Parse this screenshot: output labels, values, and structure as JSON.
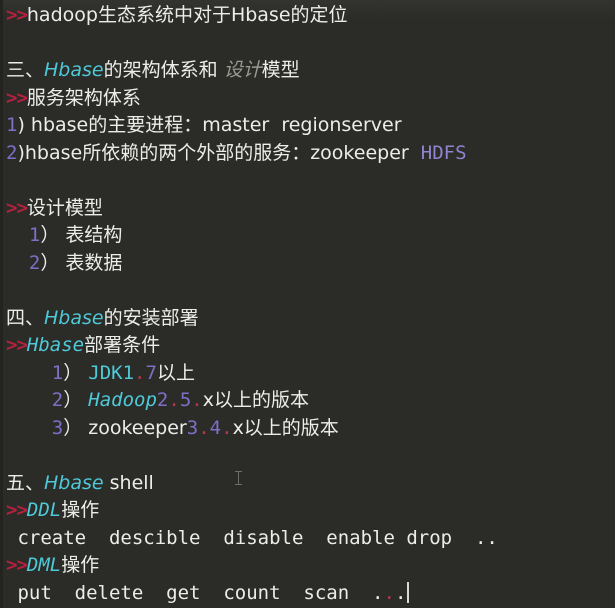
{
  "editor": {
    "theme": "dark",
    "background_color": "#2b2b27",
    "default_text_color": "#ececeb",
    "colors": {
      "marker_red": "#b4203f",
      "keyword_cyan": "#4ec9d8",
      "number_purple": "#7f6fc6",
      "lavender": "#8f84cf",
      "dot_red": "#b8344e",
      "muted_gray": "#9a9a94"
    },
    "caret_visible": true,
    "mouse_cursor": "i-beam"
  },
  "document": {
    "title": "hadoop生态系统中对于Hbase的定位",
    "lines": [
      {
        "id": "line-1",
        "kind": "sub-heading",
        "text": ">>hadoop生态系统中对于Hbase的定位",
        "tokens": [
          {
            "t": ">>",
            "c": "marker"
          },
          {
            "t": "hadoop生态系统中对于Hbase的定位",
            "c": "white"
          }
        ]
      },
      {
        "id": "line-2",
        "kind": "blank",
        "text": "",
        "tokens": []
      },
      {
        "id": "line-3",
        "kind": "heading",
        "text": "三、Hbase的架构体系和 设计模型",
        "tokens": [
          {
            "t": "三、",
            "c": "white"
          },
          {
            "t": "Hbase",
            "c": "cyan"
          },
          {
            "t": "的架构体系和 ",
            "c": "white"
          },
          {
            "t": "设计",
            "c": "gray-italic"
          },
          {
            "t": "模型",
            "c": "white"
          }
        ]
      },
      {
        "id": "line-4",
        "kind": "sub-heading",
        "text": ">>服务架构体系",
        "tokens": [
          {
            "t": ">>",
            "c": "marker"
          },
          {
            "t": "服务架构体系",
            "c": "white"
          }
        ]
      },
      {
        "id": "line-5",
        "kind": "list-item",
        "text": "1) hbase的主要进程：master  regionserver",
        "tokens": [
          {
            "t": "1",
            "c": "purple"
          },
          {
            "t": ") hbase的主要进程：master  regionserver",
            "c": "white"
          }
        ]
      },
      {
        "id": "line-6",
        "kind": "list-item",
        "text": "2)hbase所依赖的两个外部的服务：zookeeper  HDFS",
        "tokens": [
          {
            "t": "2",
            "c": "purple"
          },
          {
            "t": ")hbase所依赖的两个外部的服务：zookeeper  ",
            "c": "white"
          },
          {
            "t": "HDFS",
            "c": "lavender"
          }
        ]
      },
      {
        "id": "line-7",
        "kind": "blank",
        "text": "",
        "tokens": []
      },
      {
        "id": "line-8",
        "kind": "sub-heading",
        "text": ">>设计模型",
        "tokens": [
          {
            "t": ">>",
            "c": "marker"
          },
          {
            "t": "设计模型",
            "c": "white"
          }
        ]
      },
      {
        "id": "line-9",
        "kind": "list-item",
        "text": "  1） 表结构",
        "tokens": [
          {
            "t": "  ",
            "c": "white"
          },
          {
            "t": "1",
            "c": "purple"
          },
          {
            "t": "） 表结构",
            "c": "white"
          }
        ]
      },
      {
        "id": "line-10",
        "kind": "list-item",
        "text": "  2） 表数据",
        "tokens": [
          {
            "t": "  ",
            "c": "white"
          },
          {
            "t": "2",
            "c": "purple"
          },
          {
            "t": "） 表数据",
            "c": "white"
          }
        ]
      },
      {
        "id": "line-11",
        "kind": "blank",
        "text": "",
        "tokens": []
      },
      {
        "id": "line-12",
        "kind": "heading",
        "text": "四、Hbase的安装部署",
        "tokens": [
          {
            "t": "四、",
            "c": "white"
          },
          {
            "t": "Hbase",
            "c": "cyan"
          },
          {
            "t": "的安装部署",
            "c": "white"
          }
        ]
      },
      {
        "id": "line-13",
        "kind": "sub-heading",
        "text": ">>Hbase部署条件",
        "tokens": [
          {
            "t": ">>",
            "c": "marker"
          },
          {
            "t": "Hbase",
            "c": "cyan"
          },
          {
            "t": "部署条件",
            "c": "white"
          }
        ]
      },
      {
        "id": "line-14",
        "kind": "list-item",
        "text": "    1） JDK1.7以上",
        "tokens": [
          {
            "t": "    ",
            "c": "white"
          },
          {
            "t": "1",
            "c": "purple"
          },
          {
            "t": "） ",
            "c": "white"
          },
          {
            "t": "JDK1",
            "c": "cyan-upright"
          },
          {
            "t": ".",
            "c": "dot"
          },
          {
            "t": "7",
            "c": "purple"
          },
          {
            "t": "以上",
            "c": "white"
          }
        ]
      },
      {
        "id": "line-15",
        "kind": "list-item",
        "text": "    2） Hadoop2.5.x以上的版本",
        "tokens": [
          {
            "t": "    ",
            "c": "white"
          },
          {
            "t": "2",
            "c": "purple"
          },
          {
            "t": "） ",
            "c": "white"
          },
          {
            "t": "Hadoop",
            "c": "cyan"
          },
          {
            "t": "2",
            "c": "purple"
          },
          {
            "t": ".",
            "c": "dot"
          },
          {
            "t": "5",
            "c": "purple"
          },
          {
            "t": ".",
            "c": "dot"
          },
          {
            "t": "x以上的版本",
            "c": "white"
          }
        ]
      },
      {
        "id": "line-16",
        "kind": "list-item",
        "text": "    3） zookeeper3.4.x以上的版本",
        "tokens": [
          {
            "t": "    ",
            "c": "white"
          },
          {
            "t": "3",
            "c": "purple"
          },
          {
            "t": "） zookeeper",
            "c": "white"
          },
          {
            "t": "3",
            "c": "purple"
          },
          {
            "t": ".",
            "c": "dot"
          },
          {
            "t": "4",
            "c": "purple"
          },
          {
            "t": ".",
            "c": "dot"
          },
          {
            "t": "x以上的版本",
            "c": "white"
          }
        ]
      },
      {
        "id": "line-17",
        "kind": "blank",
        "text": "",
        "tokens": []
      },
      {
        "id": "line-18",
        "kind": "heading",
        "text": "五、Hbase shell",
        "tokens": [
          {
            "t": "五、",
            "c": "white"
          },
          {
            "t": "Hbase",
            "c": "cyan"
          },
          {
            "t": " shell",
            "c": "white"
          }
        ]
      },
      {
        "id": "line-19",
        "kind": "sub-heading",
        "text": ">>DDL操作",
        "tokens": [
          {
            "t": ">>",
            "c": "marker"
          },
          {
            "t": "DDL",
            "c": "cyan"
          },
          {
            "t": "操作",
            "c": "white"
          }
        ]
      },
      {
        "id": "line-20",
        "kind": "code",
        "text": " create  descible  disable  enable drop  ..",
        "tokens": [
          {
            "t": " create  descible  disable  enable drop  ..",
            "c": "white"
          }
        ]
      },
      {
        "id": "line-21",
        "kind": "sub-heading",
        "text": ">>DML操作",
        "tokens": [
          {
            "t": ">>",
            "c": "marker"
          },
          {
            "t": "DML",
            "c": "cyan"
          },
          {
            "t": "操作",
            "c": "white"
          }
        ]
      },
      {
        "id": "line-22",
        "kind": "code",
        "text": " put  delete  get  count  scan  ...",
        "tokens": [
          {
            "t": " put  delete  get  count  scan  .",
            "c": "white"
          },
          {
            "t": ".",
            "c": "dot"
          },
          {
            "t": ".",
            "c": "white"
          }
        ],
        "caret_at_end": true
      }
    ]
  }
}
